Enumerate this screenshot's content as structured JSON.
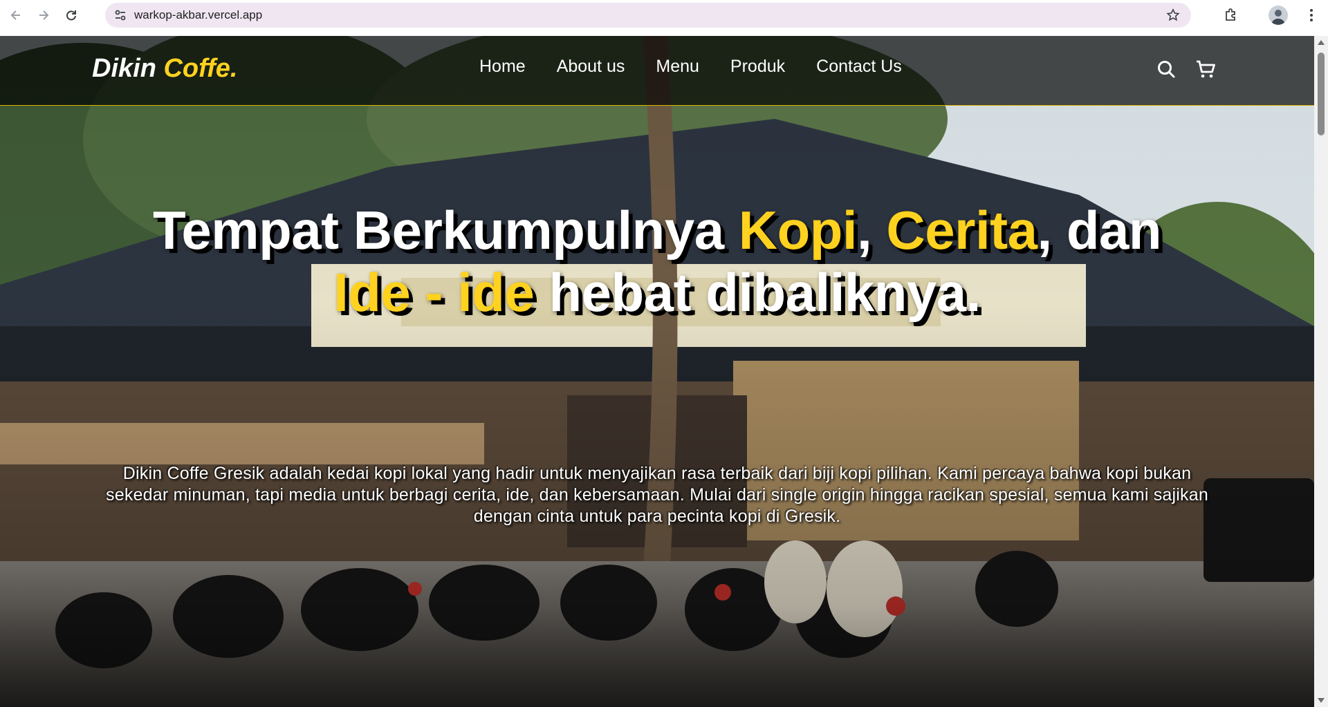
{
  "browser": {
    "url": "warkop-akbar.vercel.app",
    "icons": [
      "back-arrow-icon",
      "forward-arrow-icon",
      "reload-icon",
      "site-info-icon",
      "bookmark-star-icon",
      "extensions-icon",
      "profile-avatar",
      "more-menu-icon"
    ]
  },
  "navbar": {
    "logo_main": "Dikin",
    "logo_accent": "Coffe.",
    "links": [
      "Home",
      "About us",
      "Menu",
      "Produk",
      "Contact Us"
    ],
    "icons": [
      "search-icon",
      "shopping-cart-icon"
    ]
  },
  "hero": {
    "headline": {
      "part1": "Tempat Berkumpulnya ",
      "hl1": "Kopi",
      "part2": ", ",
      "hl2": "Cerita",
      "part3": ", dan",
      "hl3": "Ide - ide",
      "part4": " hebat dibaliknya."
    },
    "tagline": "Dikin Coffe Gresik adalah kedai kopi lokal yang hadir untuk menyajikan rasa terbaik dari biji kopi pilihan. Kami percaya bahwa kopi bukan sekedar minuman, tapi media untuk berbagi cerita, ide, dan kebersamaan. Mulai dari single origin hingga racikan spesial, semua kami sajikan dengan cinta untuk para pecinta kopi di Gresik."
  },
  "colors": {
    "accent": "#ffd21f",
    "navbar_bg": "#000000",
    "text": "#ffffff"
  }
}
